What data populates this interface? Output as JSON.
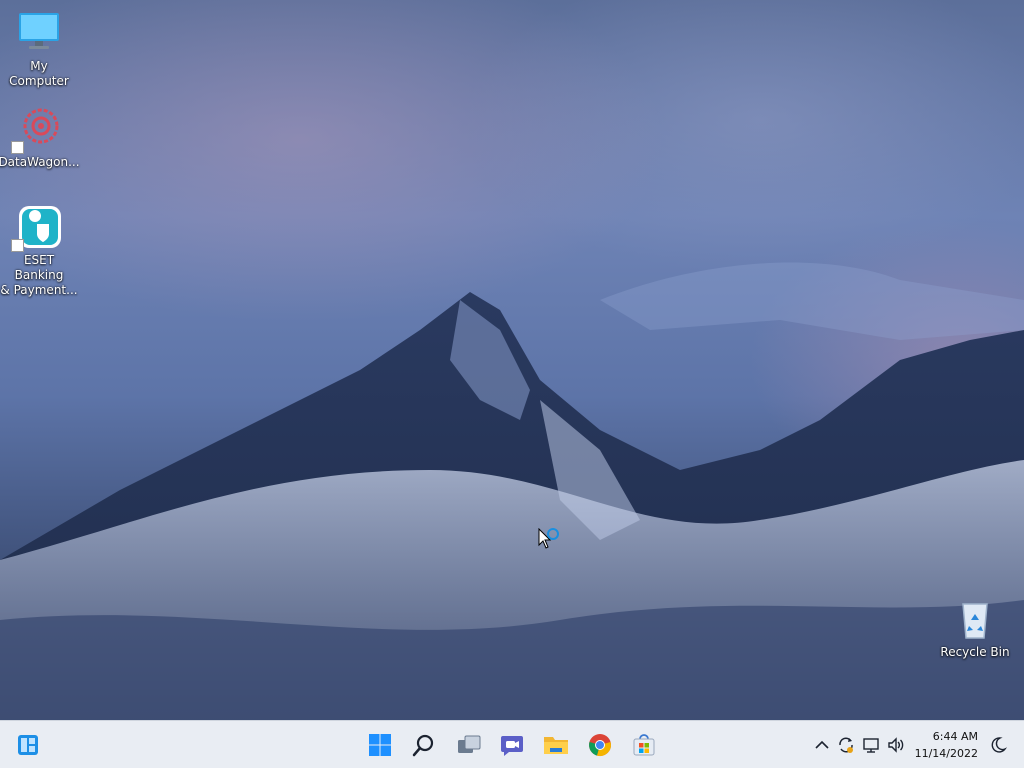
{
  "desktop": {
    "icons": [
      {
        "label": "My Computer",
        "icon": "monitor-icon"
      },
      {
        "label": "DataWagon...",
        "icon": "datawagon-icon"
      },
      {
        "label": "ESET Banking\n& Payment...",
        "icon": "eset-icon"
      },
      {
        "label": "Recycle Bin",
        "icon": "recycle-bin-icon"
      }
    ]
  },
  "taskbar": {
    "widgets_icon": "widgets-icon",
    "apps": [
      {
        "name": "Start",
        "icon": "windows-start-icon"
      },
      {
        "name": "Search",
        "icon": "search-icon"
      },
      {
        "name": "Task View",
        "icon": "task-view-icon"
      },
      {
        "name": "Chat",
        "icon": "chat-icon"
      },
      {
        "name": "File Explorer",
        "icon": "file-explorer-icon"
      },
      {
        "name": "Google Chrome",
        "icon": "chrome-icon"
      },
      {
        "name": "Microsoft Store",
        "icon": "store-icon"
      }
    ],
    "tray": {
      "time": "6:44 AM",
      "date": "11/14/2022",
      "icons": [
        "chevron-up-icon",
        "sync-icon",
        "network-icon",
        "volume-icon",
        "focus-moon-icon"
      ]
    }
  },
  "colors": {
    "accent": "#0a74d9",
    "taskbar_bg": "#e9edf3"
  }
}
